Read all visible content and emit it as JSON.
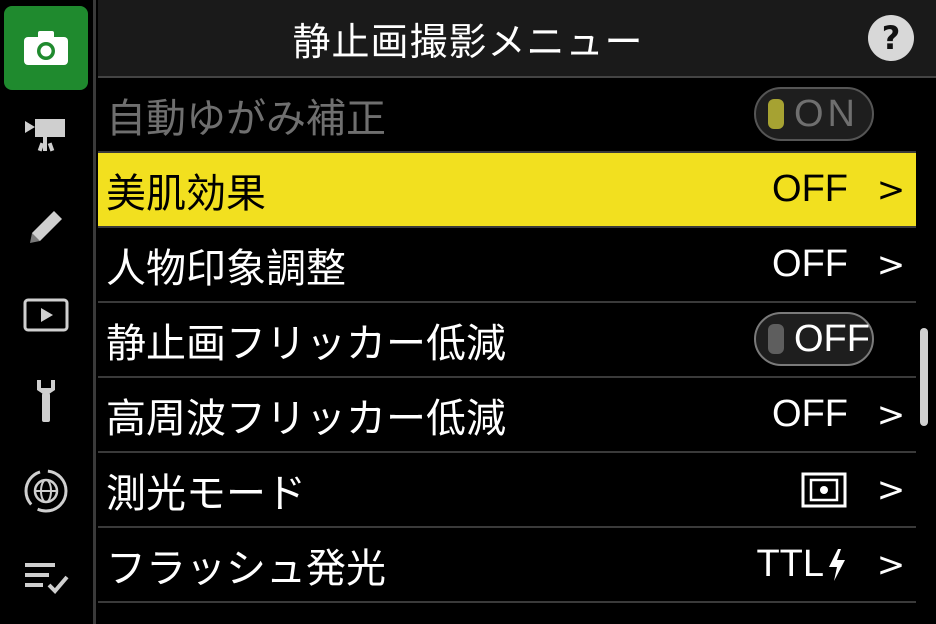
{
  "header": {
    "title": "静止画撮影メニュー",
    "help_label": "?"
  },
  "sidebar": {
    "items": [
      {
        "name": "photo-shooting-menu",
        "icon": "camera-icon",
        "active": true
      },
      {
        "name": "movie-shooting-menu",
        "icon": "movie-camera-icon",
        "active": false
      },
      {
        "name": "custom-settings-menu",
        "icon": "pencil-icon",
        "active": false
      },
      {
        "name": "playback-menu",
        "icon": "playback-icon",
        "active": false
      },
      {
        "name": "setup-menu",
        "icon": "wrench-icon",
        "active": false
      },
      {
        "name": "network-menu",
        "icon": "network-icon",
        "active": false
      },
      {
        "name": "my-menu",
        "icon": "my-menu-icon",
        "active": false
      }
    ]
  },
  "menu": {
    "items": [
      {
        "label": "自動ゆがみ補正",
        "toggle": "ON",
        "state": "disabled"
      },
      {
        "label": "美肌効果",
        "value": "OFF",
        "chevron": ">",
        "state": "selected"
      },
      {
        "label": "人物印象調整",
        "value": "OFF",
        "chevron": ">",
        "state": "normal"
      },
      {
        "label": "静止画フリッカー低減",
        "toggle": "OFF",
        "state": "normal"
      },
      {
        "label": "高周波フリッカー低減",
        "value": "OFF",
        "chevron": ">",
        "state": "normal"
      },
      {
        "label": "測光モード",
        "value_icon": "matrix-metering-icon",
        "chevron": ">",
        "state": "normal"
      },
      {
        "label": "フラッシュ発光",
        "value": "TTL",
        "value_icon": "flash-icon",
        "chevron": ">",
        "state": "normal"
      }
    ]
  },
  "colors": {
    "accent_selected": "#f2e01f",
    "active_tab": "#1f8a2e"
  }
}
